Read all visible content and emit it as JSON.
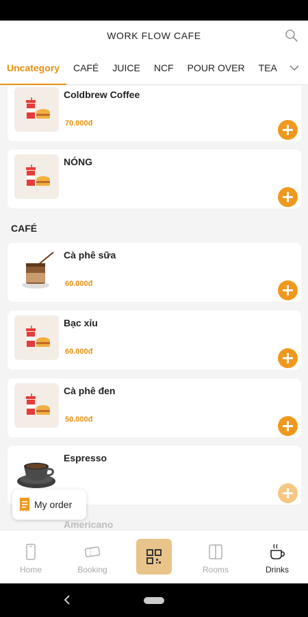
{
  "header": {
    "title": "WORK FLOW CAFE"
  },
  "tabs": [
    {
      "label": "Uncategory",
      "active": true
    },
    {
      "label": "CAFÉ",
      "active": false
    },
    {
      "label": "JUICE",
      "active": false
    },
    {
      "label": "NCF",
      "active": false
    },
    {
      "label": "POUR OVER",
      "active": false
    },
    {
      "label": "TEA",
      "active": false
    }
  ],
  "items_uncategory": [
    {
      "name": "Coldbrew Coffee",
      "price": "70.000đ"
    },
    {
      "name": "NÓNG",
      "price": ""
    }
  ],
  "section_cafe": {
    "title": "CAFÉ"
  },
  "items_cafe": [
    {
      "name": "Cà phê sữa",
      "price": "60.000đ"
    },
    {
      "name": "Bạc xỉu",
      "price": "60.000đ"
    },
    {
      "name": "Cà phê đen",
      "price": "50.000đ"
    },
    {
      "name": "Espresso",
      "price": ""
    }
  ],
  "partially_visible_item": {
    "name": "Americano"
  },
  "my_order": {
    "label": "My order"
  },
  "bottom_nav": [
    {
      "label": "Home",
      "icon": "phone-icon",
      "active": false
    },
    {
      "label": "Booking",
      "icon": "ticket-icon",
      "active": false
    },
    {
      "label": "",
      "icon": "qr-code-icon",
      "active": false
    },
    {
      "label": "Rooms",
      "icon": "door-icon",
      "active": false
    },
    {
      "label": "Drinks",
      "icon": "coffee-cup-icon",
      "active": true
    }
  ],
  "colors": {
    "accent": "#e8900f",
    "add_button": "#f0981e",
    "qr_button": "#e9c48a"
  }
}
